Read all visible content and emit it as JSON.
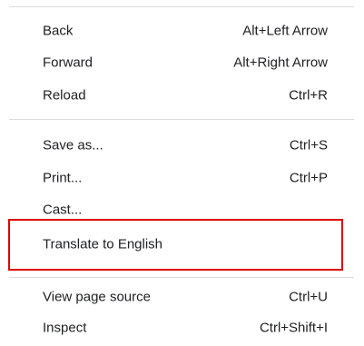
{
  "context_menu": {
    "items": [
      {
        "label": "Back",
        "shortcut": "Alt+Left Arrow"
      },
      {
        "label": "Forward",
        "shortcut": "Alt+Right Arrow"
      },
      {
        "label": "Reload",
        "shortcut": "Ctrl+R"
      },
      {
        "label": "Save as...",
        "shortcut": "Ctrl+S"
      },
      {
        "label": "Print...",
        "shortcut": "Ctrl+P"
      },
      {
        "label": "Cast...",
        "shortcut": ""
      },
      {
        "label": "Translate to English",
        "shortcut": ""
      },
      {
        "label": "View page source",
        "shortcut": "Ctrl+U"
      },
      {
        "label": "Inspect",
        "shortcut": "Ctrl+Shift+I"
      }
    ]
  },
  "colors": {
    "highlight_border": "#e00000",
    "separator": "#dadce0",
    "text": "#202124"
  }
}
